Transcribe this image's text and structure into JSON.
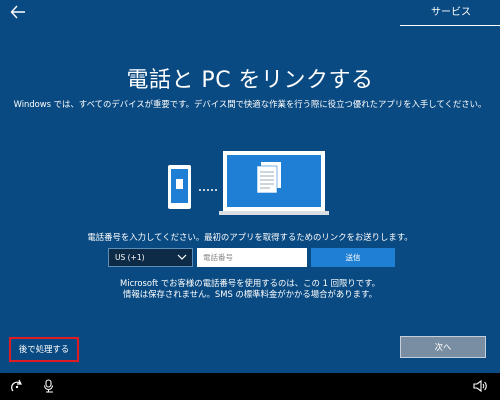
{
  "header": {
    "back_icon": "arrow-left-icon",
    "active_tab": "サービス"
  },
  "main": {
    "title": "電話と PC をリンクする",
    "subtitle": "Windows では、すべてのデバイスが重要です。デバイス間で快適な作業を行う際に役立つ優れたアプリを入手してください。",
    "instruction": "電話番号を入力してください。最初のアプリを取得するためのリンクをお送りします。",
    "country_code": {
      "selected": "US (+1)",
      "icon": "chevron-down-icon"
    },
    "phone_field": {
      "value": "",
      "placeholder": "電話番号"
    },
    "send_label": "送信",
    "privacy_line1": "Microsoft でお客様の電話番号を使用するのは、この 1 回限りです。",
    "privacy_line2": "情報は保存されません。SMS の標準料金がかかる場合があります。"
  },
  "footer": {
    "later_label": "後で処理する",
    "next_label": "次へ"
  },
  "taskbar": {
    "icons": [
      "accessibility-icon",
      "microphone-icon",
      "volume-icon"
    ]
  },
  "colors": {
    "background": "#0a4a82",
    "accent": "#1f7fd4",
    "highlight_border": "#e01b24",
    "taskbar": "#000000"
  }
}
